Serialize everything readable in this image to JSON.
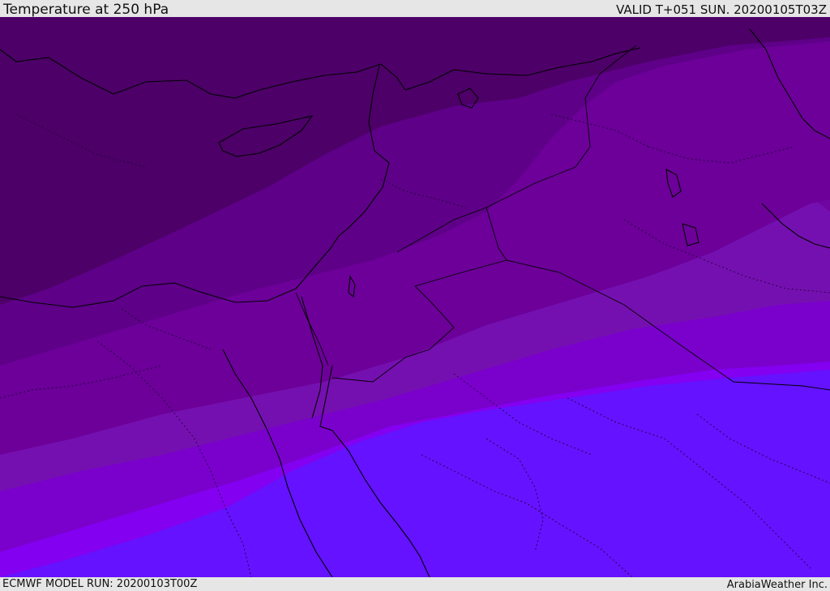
{
  "header": {
    "title": "Temperature at 250 hPa",
    "valid_time": "VALID T+051 SUN. 20200105T03Z"
  },
  "footer": {
    "model_run": "ECMWF MODEL RUN: 20200103T00Z",
    "credit": "ArabiaWeather Inc."
  },
  "map": {
    "field": "temperature",
    "level": "250 hPa",
    "band_colors": [
      "#4d0068",
      "#5e0088",
      "#6c0099",
      "#7510b0",
      "#7a00cc",
      "#8400f0",
      "#6412ff"
    ],
    "coastline_color": "#000000",
    "border_style": "dotted"
  }
}
